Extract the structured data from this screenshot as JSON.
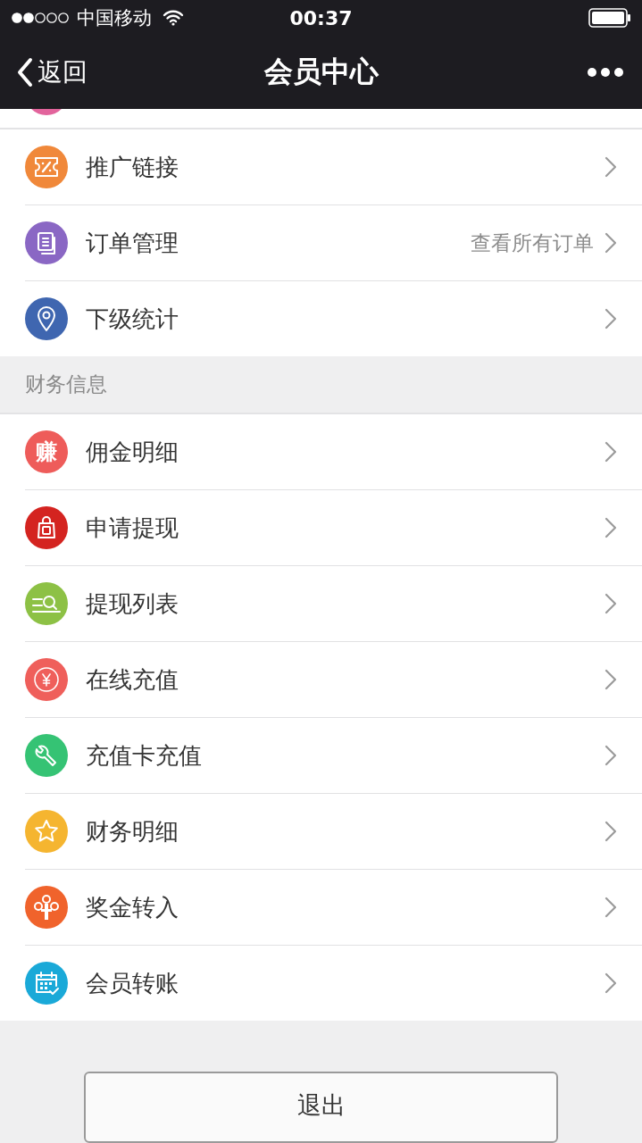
{
  "status_bar": {
    "carrier": "中国移动",
    "time": "00:37"
  },
  "nav_bar": {
    "back": "返回",
    "title": "会员中心"
  },
  "peek_item": {
    "color": "#e2649c"
  },
  "groups": [
    {
      "items": [
        {
          "kind": "coupon",
          "color": "#f0883a",
          "label": "推广链接"
        },
        {
          "kind": "document",
          "color": "#8a67c4",
          "label": "订单管理",
          "detail": "查看所有订单"
        },
        {
          "kind": "location",
          "color": "#3f66b0",
          "label": "下级统计"
        }
      ]
    },
    {
      "header": "财务信息",
      "items": [
        {
          "kind": "glyph",
          "color": "#ee5c5a",
          "glyph": "赚",
          "label": "佣金明细"
        },
        {
          "kind": "bag",
          "color": "#d42420",
          "label": "申请提现"
        },
        {
          "kind": "search",
          "color": "#8dc145",
          "label": "提现列表"
        },
        {
          "kind": "yen",
          "color": "#ef5f5b",
          "label": "在线充值"
        },
        {
          "kind": "wrench",
          "color": "#35c374",
          "label": "充值卡充值"
        },
        {
          "kind": "star",
          "color": "#f5b530",
          "label": "财务明细"
        },
        {
          "kind": "tree",
          "color": "#f0632c",
          "label": "奖金转入"
        },
        {
          "kind": "calendar",
          "color": "#1aa9d8",
          "label": "会员转账"
        }
      ]
    }
  ],
  "logout_button": "退出"
}
